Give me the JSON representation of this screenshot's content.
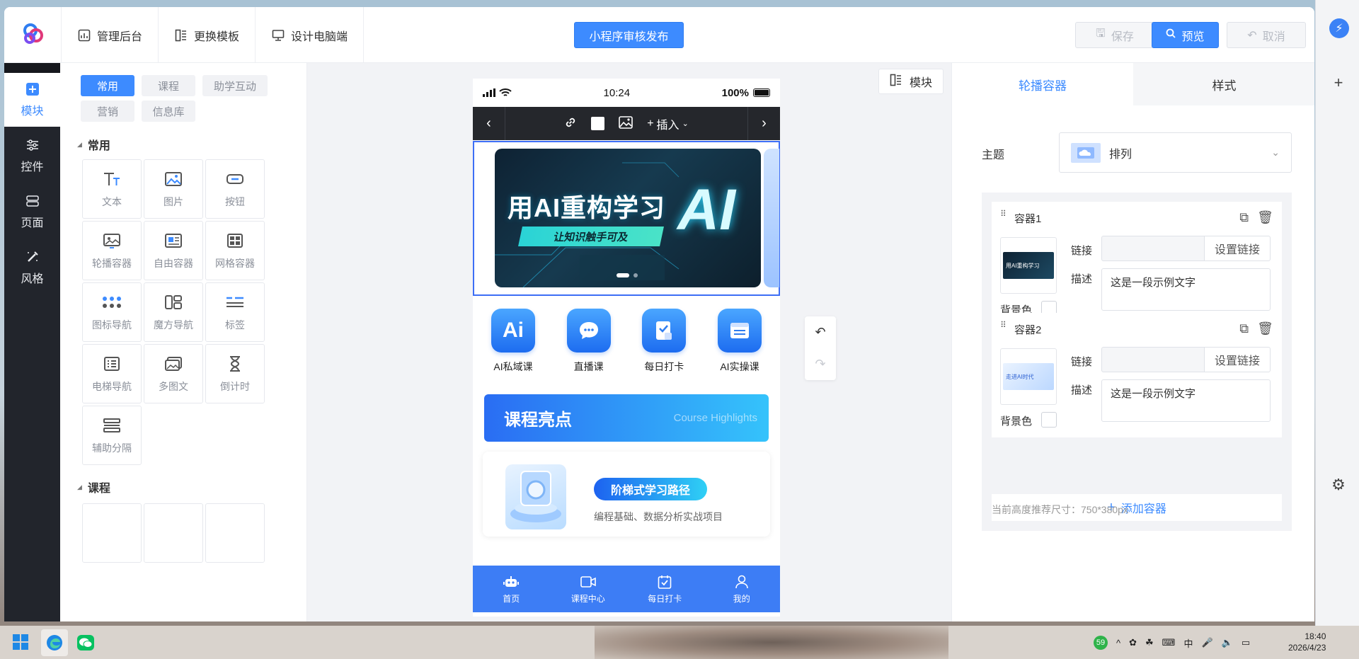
{
  "topbar": {
    "nav": [
      {
        "label": "管理后台",
        "icon": "chart-icon"
      },
      {
        "label": "更换模板",
        "icon": "template-icon"
      },
      {
        "label": "设计电脑端",
        "icon": "monitor-icon"
      }
    ],
    "publish_label": "小程序审核发布",
    "save_label": "保存",
    "preview_label": "预览",
    "cancel_label": "取消"
  },
  "rail": {
    "items": [
      {
        "label": "模块",
        "icon": "plus-square-icon",
        "active": true
      },
      {
        "label": "控件",
        "icon": "sliders-icon"
      },
      {
        "label": "页面",
        "icon": "page-icon"
      },
      {
        "label": "风格",
        "icon": "brush-icon"
      }
    ]
  },
  "component_panel": {
    "chips": [
      "常用",
      "课程",
      "助学互动",
      "营销",
      "信息库"
    ],
    "section_common": "常用",
    "section_course": "课程",
    "tiles": [
      {
        "label": "文本",
        "icon": "text-icon"
      },
      {
        "label": "图片",
        "icon": "image-icon"
      },
      {
        "label": "按钮",
        "icon": "button-icon"
      },
      {
        "label": "轮播容器",
        "icon": "carousel-icon"
      },
      {
        "label": "自由容器",
        "icon": "free-container-icon"
      },
      {
        "label": "网格容器",
        "icon": "grid-icon"
      },
      {
        "label": "图标导航",
        "icon": "icon-nav-icon"
      },
      {
        "label": "魔方导航",
        "icon": "cube-nav-icon"
      },
      {
        "label": "标签",
        "icon": "tag-icon"
      },
      {
        "label": "电梯导航",
        "icon": "elevator-nav-icon"
      },
      {
        "label": "多图文",
        "icon": "multi-image-icon"
      },
      {
        "label": "倒计时",
        "icon": "hourglass-icon"
      },
      {
        "label": "辅助分隔",
        "icon": "divider-icon"
      }
    ]
  },
  "canvas": {
    "module_btn": "模块",
    "phone": {
      "status_time": "10:24",
      "battery": "100%",
      "insert_label": "插入",
      "banner": {
        "title": "用AI重构学习",
        "subtitle": "让知识触手可及",
        "big_text": "AI"
      },
      "icon_nav": [
        {
          "label": "AI私域课",
          "glyph": "Ai"
        },
        {
          "label": "直播课",
          "glyph": "…"
        },
        {
          "label": "每日打卡",
          "glyph": "✓"
        },
        {
          "label": "AI实操课",
          "glyph": "▤"
        }
      ],
      "highlights": {
        "cn": "课程亮点",
        "en": "Course Highlights"
      },
      "course_card": {
        "tag": "阶梯式学习路径",
        "desc": "编程基础、数据分析实战项目"
      },
      "tabs": [
        {
          "label": "首页",
          "icon": "robot-icon"
        },
        {
          "label": "课程中心",
          "icon": "video-icon"
        },
        {
          "label": "每日打卡",
          "icon": "calendar-check-icon"
        },
        {
          "label": "我的",
          "icon": "user-icon"
        }
      ]
    }
  },
  "props": {
    "tabs": [
      "轮播容器",
      "样式"
    ],
    "theme_label": "主题",
    "theme_value": "排列",
    "containers": [
      {
        "name": "容器1",
        "link_label": "链接",
        "link_btn": "设置链接",
        "desc_label": "描述",
        "desc_value": "这是一段示例文字",
        "bg_label": "背景色",
        "thumb_text": "用AI重构学习"
      },
      {
        "name": "容器2",
        "link_label": "链接",
        "link_btn": "设置链接",
        "desc_label": "描述",
        "desc_value": "这是一段示例文字",
        "bg_label": "背景色",
        "thumb_text": "走进AI时代"
      }
    ],
    "add_label": "添加容器",
    "hint": "当前高度推荐尺寸：750*380px"
  },
  "taskbar": {
    "badge": "59",
    "tray": [
      "^",
      "中"
    ],
    "time": "18:40",
    "date": "2026/4/23"
  },
  "colors": {
    "accent": "#3d8bff",
    "rail": "#22252c",
    "tabbar": "#3d7df5"
  }
}
